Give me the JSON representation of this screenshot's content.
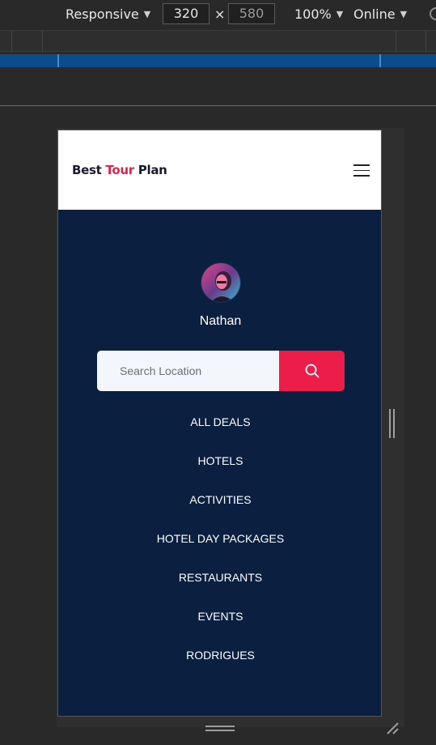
{
  "devtools": {
    "device_mode": "Responsive",
    "width": "320",
    "height": "580",
    "times": "×",
    "zoom": "100%",
    "throttling": "Online"
  },
  "site": {
    "logo_part1": "Best ",
    "logo_part2": "Tour",
    "logo_part3": " Plan",
    "user_name": "Nathan",
    "search_placeholder": "Search Location",
    "nav": [
      "ALL DEALS",
      "HOTELS",
      "ACTIVITIES",
      "HOTEL DAY PACKAGES",
      "RESTAURANTS",
      "EVENTS",
      "RODRIGUES"
    ],
    "colors": {
      "brand_red": "#e8204a",
      "panel_navy": "#0b2040",
      "search_button": "#ec1d49"
    },
    "icons": [
      "hamburger-menu-icon",
      "search-icon",
      "avatar-photo"
    ]
  }
}
